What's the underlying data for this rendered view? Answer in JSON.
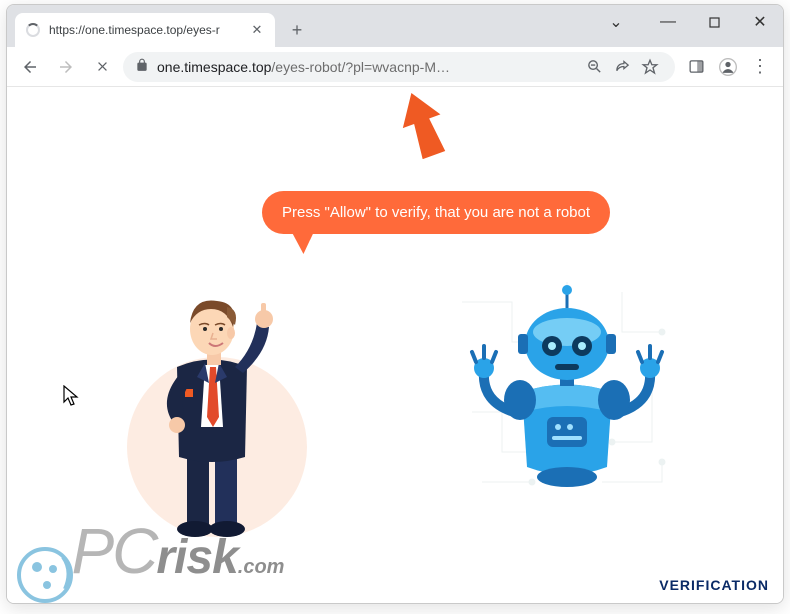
{
  "window_controls": {
    "dropdown": "⌄",
    "minimize": "—",
    "maximize": "▢",
    "close": "✕"
  },
  "tab": {
    "title": "https://one.timespace.top/eyes-r",
    "close": "✕",
    "new_tab": "+"
  },
  "toolbar": {
    "back": "←",
    "forward": "→",
    "stop": "✕",
    "lock": "🔒",
    "url_host": "one.timespace.top",
    "url_path": "/eyes-robot/?pl=wvacnp-M…",
    "zoom": "⌕",
    "share": "↗",
    "star": "☆",
    "panel": "▣",
    "profile": "👤",
    "menu": "⋮"
  },
  "page": {
    "bubble_text": "Press \"Allow\" to verify, that you are not a robot",
    "verification_label": "VERIFICATION",
    "colors": {
      "bubble": "#ff6a3a",
      "robot_primary": "#2aa3e8",
      "robot_secondary": "#1b6fb5",
      "accent_orange": "#ef5a23",
      "suit": "#1b2644",
      "tie": "#e24a2b"
    }
  },
  "watermark": {
    "pc": "PC",
    "risk": "risk",
    "com": ".com"
  }
}
